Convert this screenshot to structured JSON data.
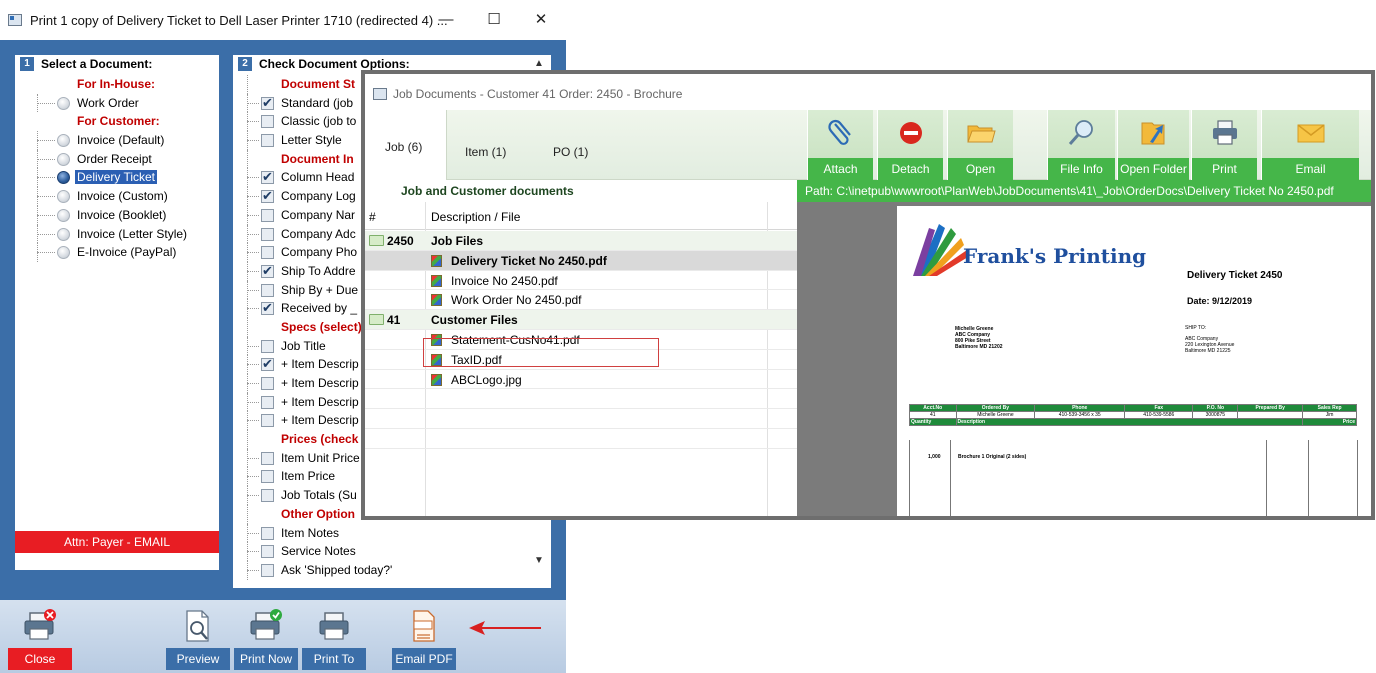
{
  "dialog": {
    "title": "Print 1 copy of Delivery Ticket to Dell Laser Printer 1710 (redirected 4) ...",
    "min_glyph": "—",
    "max_glyph": "☐",
    "close_glyph": "✕",
    "left_panel": {
      "num": "1",
      "header": "Select a Document:",
      "items": [
        {
          "label": "For In-House:",
          "type": "group"
        },
        {
          "label": "Work Order",
          "type": "radio"
        },
        {
          "label": "For Customer:",
          "type": "group"
        },
        {
          "label": "Invoice (Default)",
          "type": "radio"
        },
        {
          "label": "Order Receipt",
          "type": "radio"
        },
        {
          "label": "Delivery Ticket",
          "type": "radio",
          "selected": true
        },
        {
          "label": "Invoice (Custom)",
          "type": "radio"
        },
        {
          "label": "Invoice (Booklet)",
          "type": "radio"
        },
        {
          "label": "Invoice (Letter Style)",
          "type": "radio"
        },
        {
          "label": "E-Invoice (PayPal)",
          "type": "radio"
        }
      ]
    },
    "right_panel": {
      "num": "2",
      "header": "Check Document Options:",
      "items": [
        {
          "label": "Document St",
          "type": "group"
        },
        {
          "label": "Standard (job",
          "checked": true
        },
        {
          "label": "Classic (job to",
          "checked": false
        },
        {
          "label": "Letter Style",
          "checked": false
        },
        {
          "label": "Document In",
          "type": "group"
        },
        {
          "label": "Column Head",
          "checked": true
        },
        {
          "label": "Company Log",
          "checked": true
        },
        {
          "label": "Company Nar",
          "checked": false
        },
        {
          "label": "Company Adc",
          "checked": false
        },
        {
          "label": "Company Pho",
          "checked": false
        },
        {
          "label": "Ship To Addre",
          "checked": true
        },
        {
          "label": "Ship By + Due",
          "checked": false
        },
        {
          "label": "Received by _",
          "checked": true
        },
        {
          "label": "Specs (select)",
          "type": "group"
        },
        {
          "label": "Job Title",
          "checked": false
        },
        {
          "label": "+ Item Descrip",
          "checked": true
        },
        {
          "label": "+ Item Descrip",
          "checked": false
        },
        {
          "label": "+ Item Descrip",
          "checked": false
        },
        {
          "label": "+ Item Descrip",
          "checked": false
        },
        {
          "label": "Prices (check",
          "type": "group"
        },
        {
          "label": "Item Unit Price",
          "checked": false
        },
        {
          "label": "Item Price",
          "checked": false
        },
        {
          "label": "Job Totals (Su",
          "checked": false
        },
        {
          "label": "Other Option",
          "type": "group"
        },
        {
          "label": "Item Notes",
          "checked": false
        },
        {
          "label": "Service Notes",
          "checked": false
        },
        {
          "label": "Ask 'Shipped today?'",
          "checked": false
        }
      ],
      "scroll_up": "▲",
      "scroll_down": "▼"
    },
    "attn": "Attn: Payer - EMAIL",
    "footer": {
      "close": "Close",
      "preview": "Preview",
      "print_now": "Print Now",
      "print_to": "Print To",
      "email_pdf": "Email PDF"
    }
  },
  "window": {
    "title": "Job Documents - Customer 41 Order: 2450 - Brochure",
    "tabs": [
      "Job (6)",
      "Item (1)",
      "PO (1)"
    ],
    "toolbar": {
      "attach": "Attach",
      "detach": "Detach",
      "open": "Open",
      "file_info": "File Info",
      "open_folder": "Open Folder",
      "print": "Print",
      "email": "Email"
    },
    "list": {
      "title": "Job and Customer documents",
      "col_num": "#",
      "col_desc": "Description / File",
      "groups": [
        {
          "num": "2450",
          "name": "Job Files",
          "files": [
            "Delivery Ticket No 2450.pdf",
            "Invoice No 2450.pdf",
            "Work Order No 2450.pdf"
          ]
        },
        {
          "num": "41",
          "name": "Customer Files",
          "files": [
            "Statement-CusNo41.pdf",
            "TaxID.pdf",
            "ABCLogo.jpg"
          ]
        }
      ],
      "selected_file": "Delivery Ticket No 2450.pdf"
    },
    "path": "Path: C:\\inetpub\\wwwroot\\PlanWeb\\JobDocuments\\41\\_Job\\OrderDocs\\Delivery Ticket No 2450.pdf",
    "preview": {
      "company": "Frank's Printing",
      "heading": "Delivery Ticket 2450",
      "date": "Date: 9/12/2019",
      "bill_to": [
        "Michelle Greene",
        "ABC Company",
        "800 Pike Street",
        "Baltimore MD 21202"
      ],
      "ship_to_label": "SHIP TO:",
      "ship_to": [
        "ABC Company",
        "220 Lexington Avenue",
        "Baltimore MD 21225"
      ],
      "table_headers": [
        "Acct.No",
        "Ordered By",
        "Phone",
        "Fax",
        "P.O. No",
        "Prepared By",
        "Sales Rep"
      ],
      "table_values": [
        "41",
        "Michelle Greene",
        "410-539-3456 x 35",
        "410-539-5586",
        "3000875",
        "",
        "Jim"
      ],
      "sub_headers": [
        "Quantity",
        "Description",
        "Price"
      ],
      "line_qty": "1,000",
      "line_desc": "Brochure   1 Original (2 sides)"
    }
  }
}
